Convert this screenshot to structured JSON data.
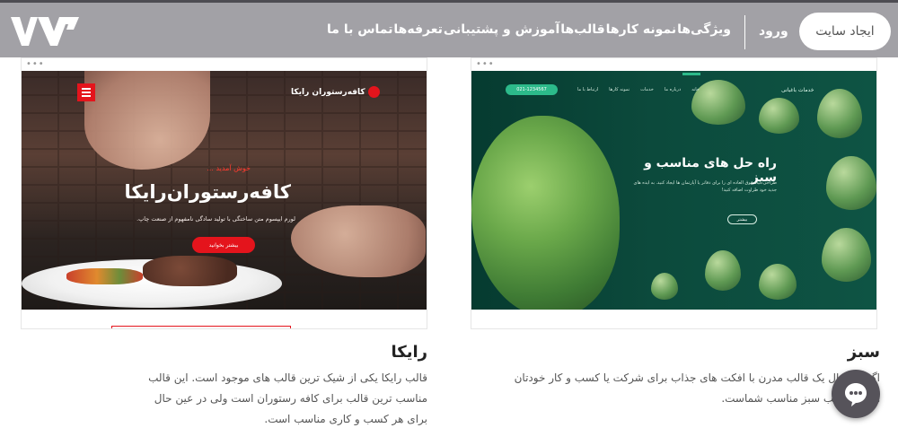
{
  "header": {
    "cta_label": "ایجاد سایت",
    "login_label": "ورود",
    "nav": [
      "ویژگی‌ها",
      "نمونه کارها",
      "قالب‌ها",
      "آموزش و پشتیبانی",
      "تعرفه‌ها",
      "تماس با ما"
    ]
  },
  "cards": [
    {
      "title": "سبز",
      "description": "اگر به دنبال یک قالب مدرن با افکت های جذاب برای شرکت یا کسب و کار خودتان هستید، قالب سبز مناسب شماست.",
      "preview": {
        "brand": "خدمات باغبانی",
        "heading": "راه حل های مناسب و سبز",
        "subtext": "طراحی گیاه فوق العاده ای را برای دفاتر یا آپارتمان ها ایجاد کنید. به ایده های جدید خود طراوت اضافه کنید!",
        "button": "بیشتر",
        "pill": "021-1234567",
        "nav": [
          "خانه",
          "درباره ما",
          "خدمات",
          "نمونه کارها",
          "ارتباط با ما"
        ]
      }
    },
    {
      "title": "رایکا",
      "description": "قالب رایکا یکی از شیک ترین قالب های موجود است. این قالب مناسب ترین قالب برای کافه رستوران است ولی در عین حال برای هر کسب و کاری مناسب است.",
      "preview": {
        "brand": "کافه‌رستوران رایکا",
        "welcome": "خوش آمدید ...",
        "heading": "کافه‌رستوران‌رایکا",
        "subtext": "لورم ایپسوم متن ساختگی با تولید سادگی نامفهوم از صنعت چاپ.",
        "button": "بیشتر بخوانید"
      }
    }
  ],
  "colors": {
    "header_bg": "#a2a1a6",
    "accent_red": "#e4141c",
    "accent_green": "#2cba8a"
  },
  "icons": [
    "logo-mark",
    "hamburger-icon",
    "chat-icon"
  ]
}
